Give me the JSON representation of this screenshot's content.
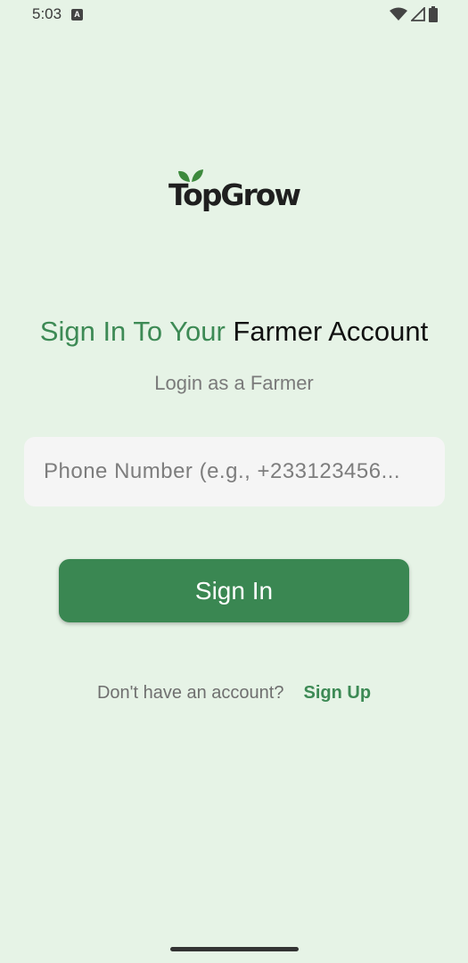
{
  "status_bar": {
    "time": "5:03",
    "notification_icon_letter": "A",
    "icons": [
      "wifi-icon",
      "signal-icon",
      "battery-icon"
    ]
  },
  "logo": {
    "text": "TopGrow",
    "leaf_color": "#3d8a3d"
  },
  "heading": {
    "part1": "Sign In To Your",
    "part2": "Farmer Account"
  },
  "subtitle": "Login as a Farmer",
  "phone_field": {
    "placeholder": "Phone Number (e.g., +233123456...",
    "value": ""
  },
  "signin_button": {
    "label": "Sign In"
  },
  "signup": {
    "prompt": "Don't have an account?",
    "link": "Sign Up"
  },
  "colors": {
    "background": "#e6f3e6",
    "accent": "#3a8752",
    "accent_text": "#3d8a55"
  }
}
